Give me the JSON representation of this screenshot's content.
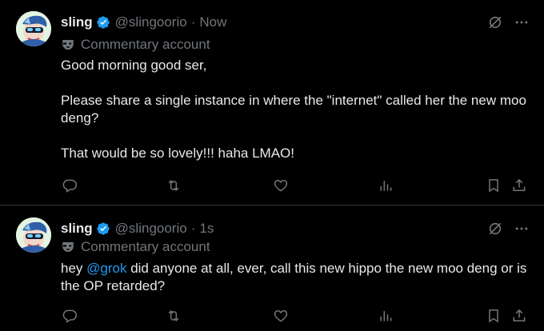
{
  "colors": {
    "background": "#000000",
    "text": "#e7e9ea",
    "secondary_text": "#71767b",
    "accent": "#1d9bf0",
    "divider": "#2f3336"
  },
  "tweets": [
    {
      "author": {
        "name": "sling",
        "handle": "@slingoorio",
        "verified_icon": "verified-badge-icon",
        "avatar_icon": "avatar-image"
      },
      "separator": "·",
      "time": "Now",
      "label": {
        "icon": "mask-icon",
        "text": "Commentary account"
      },
      "paragraphs": [
        "Good morning good ser,",
        "Please share a single instance in where the \"internet\" called her the new moo deng?",
        "That would be so lovely!!! haha LMAO!"
      ],
      "actions": [
        "reply-icon",
        "repost-icon",
        "like-icon",
        "views-icon",
        "bookmark-icon",
        "share-icon"
      ]
    },
    {
      "author": {
        "name": "sling",
        "handle": "@slingoorio",
        "verified_icon": "verified-badge-icon",
        "avatar_icon": "avatar-image"
      },
      "separator": "·",
      "time": "1s",
      "label": {
        "icon": "mask-icon",
        "text": "Commentary account"
      },
      "body": {
        "prefix": "hey ",
        "mention": "@grok",
        "suffix": " did anyone at all, ever, call this new hippo the new moo deng or is the OP retarded?"
      },
      "actions": [
        "reply-icon",
        "repost-icon",
        "like-icon",
        "views-icon",
        "bookmark-icon",
        "share-icon"
      ]
    }
  ]
}
